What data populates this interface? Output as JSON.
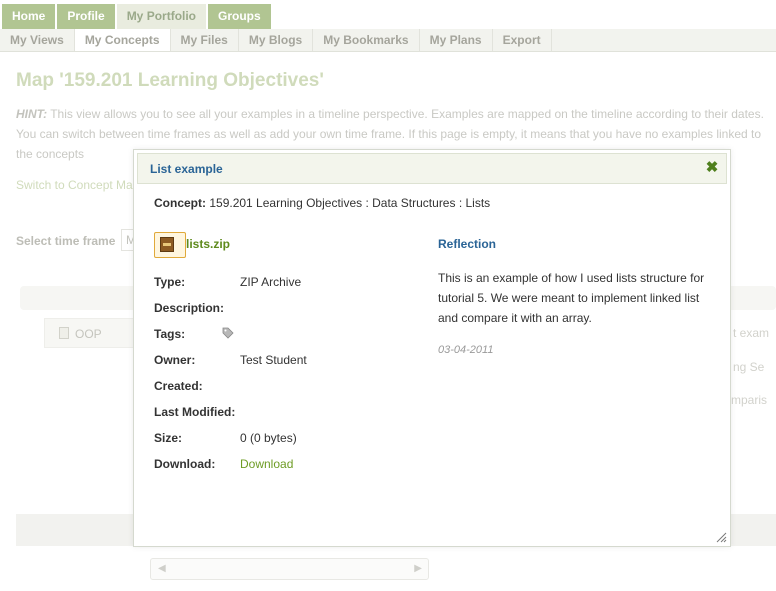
{
  "nav": {
    "main_tabs": [
      "Home",
      "Profile",
      "My Portfolio",
      "Groups"
    ],
    "sub_tabs": [
      "My Views",
      "My Concepts",
      "My Files",
      "My Blogs",
      "My Bookmarks",
      "My Plans",
      "Export"
    ]
  },
  "page": {
    "title": "Map '159.201 Learning Objectives'",
    "hint_label": "HINT:",
    "hint_text": " This view allows you to see all your examples in a timeline perspective. Examples are mapped on the timeline according to their dates. You can switch between time frames as well as add your own time frame. If this page is empty, it means that you have no examples linked to the concepts",
    "switch_link": "Switch to Concept Ma",
    "time_frame_label": "Select time frame",
    "time_frame_value": "M",
    "timeline_item": "OOP",
    "ghost_texts": [
      "t exam",
      "ng Se",
      "mparis"
    ]
  },
  "modal": {
    "title": "List example",
    "concept_label": "Concept:",
    "concept_value": "159.201 Learning Objectives : Data Structures : Lists",
    "file_name": "lists.zip",
    "props": {
      "type_label": "Type:",
      "type_value": "ZIP Archive",
      "description_label": "Description:",
      "tags_label": "Tags:",
      "owner_label": "Owner:",
      "owner_value": "Test Student",
      "created_label": "Created:",
      "modified_label": "Last Modified:",
      "size_label": "Size:",
      "size_value": "0 (0 bytes)",
      "download_label": "Download:",
      "download_value": "Download"
    },
    "reflection_title": "Reflection",
    "reflection_text": "This is an example of how I used lists structure for tutorial 5. We were meant to implement linked list and compare it with an array.",
    "reflection_date": "03-04-2011"
  },
  "colors": {
    "accent_green": "#b1c592",
    "link_blue": "#2a6496",
    "link_green": "#6e9c25"
  },
  "icons": [
    "close-icon",
    "zip-file-icon",
    "tag-icon",
    "document-icon",
    "resize-grip-icon",
    "scroll-left-icon",
    "scroll-right-icon"
  ]
}
